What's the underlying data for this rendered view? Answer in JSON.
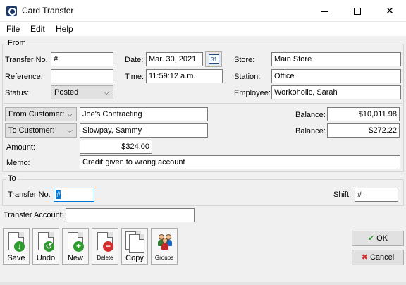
{
  "window": {
    "title": "Card Transfer",
    "icon": "app-icon"
  },
  "menu": [
    "File",
    "Edit",
    "Help"
  ],
  "from": {
    "legend": "From",
    "transfer_no_label": "Transfer No.",
    "transfer_no": "#",
    "date_label": "Date:",
    "date": "Mar. 30, 2021",
    "calendar_glyph": "31",
    "store_label": "Store:",
    "store": "Main Store",
    "reference_label": "Reference:",
    "reference": "",
    "time_label": "Time:",
    "time": "11:59:12 a.m.",
    "station_label": "Station:",
    "station": "Office",
    "status_label": "Status:",
    "status": "Posted",
    "employee_label": "Employee:",
    "employee": "Workoholic, Sarah",
    "from_customer_label": "From Customer:",
    "from_customer": "Joe's Contracting",
    "balance_label_1": "Balance:",
    "balance_1": "$10,011.98",
    "to_customer_label": "To Customer:",
    "to_customer": "Slowpay, Sammy",
    "balance_label_2": "Balance:",
    "balance_2": "$272.22",
    "amount_label": "Amount:",
    "amount": "$324.00",
    "memo_label": "Memo:",
    "memo": "Credit given to wrong account"
  },
  "to": {
    "legend": "To",
    "transfer_no_label": "Transfer No.",
    "transfer_no": "#",
    "shift_label": "Shift:",
    "shift": "#"
  },
  "transfer_account_label": "Transfer Account:",
  "transfer_account": "",
  "toolbar": {
    "save": "Save",
    "undo": "Undo",
    "new": "New",
    "delete": "Delete",
    "copy": "Copy",
    "groups": "Groups"
  },
  "actions": {
    "ok": "OK",
    "cancel": "Cancel"
  },
  "colors": {
    "accent_green": "#2e9b2e",
    "accent_red": "#d32f2f",
    "focus_blue": "#0078d7"
  }
}
